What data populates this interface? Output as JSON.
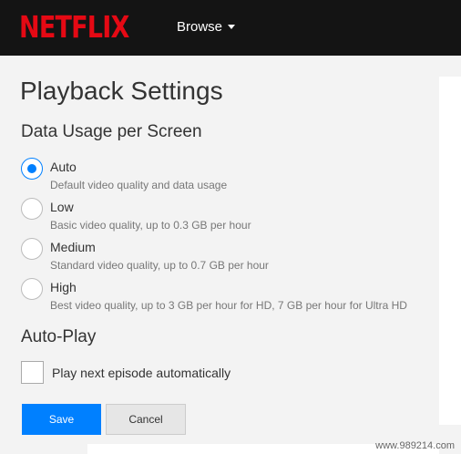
{
  "header": {
    "logo_text": "NETFLIX",
    "browse_label": "Browse"
  },
  "page": {
    "title": "Playback Settings"
  },
  "data_usage": {
    "heading": "Data Usage per Screen",
    "selected": "Auto",
    "options": [
      {
        "label": "Auto",
        "description": "Default video quality and data usage",
        "checked": true
      },
      {
        "label": "Low",
        "description": "Basic video quality, up to 0.3 GB per hour",
        "checked": false
      },
      {
        "label": "Medium",
        "description": "Standard video quality, up to 0.7 GB per hour",
        "checked": false
      },
      {
        "label": "High",
        "description": "Best video quality, up to 3 GB per hour for HD, 7 GB per hour for Ultra HD",
        "checked": false
      }
    ]
  },
  "autoplay": {
    "heading": "Auto-Play",
    "checkbox_label": "Play next episode automatically",
    "checked": false
  },
  "buttons": {
    "save_label": "Save",
    "cancel_label": "Cancel"
  },
  "watermark": "www.989214.com",
  "colors": {
    "brand_red": "#e50914",
    "accent_blue": "#0080ff",
    "topbar": "#141414"
  }
}
